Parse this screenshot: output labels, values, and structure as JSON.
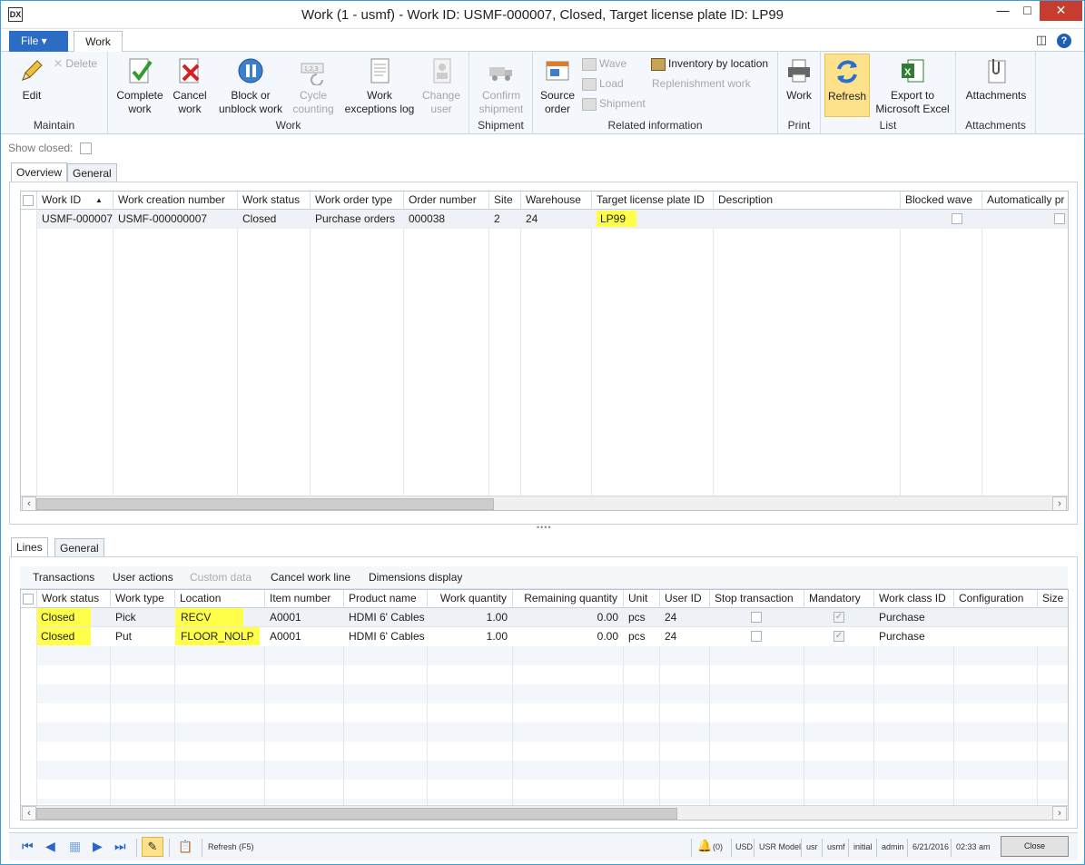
{
  "window": {
    "title": "Work (1 - usmf) - Work ID: USMF-000007, Closed, Target license plate ID: LP99"
  },
  "tabs": {
    "file": "File",
    "work": "Work"
  },
  "ribbon": {
    "maintain": {
      "label": "Maintain",
      "edit": "Edit",
      "delete": "Delete"
    },
    "work": {
      "label": "Work",
      "complete": [
        "Complete",
        "work"
      ],
      "cancel": [
        "Cancel",
        "work"
      ],
      "block": [
        "Block or",
        "unblock work"
      ],
      "cycle": [
        "Cycle",
        "counting"
      ],
      "exceptions": [
        "Work",
        "exceptions log"
      ],
      "change": [
        "Change",
        "user"
      ]
    },
    "shipment": {
      "label": "Shipment",
      "confirm": [
        "Confirm",
        "shipment"
      ]
    },
    "related": {
      "label": "Related information",
      "source": [
        "Source",
        "order"
      ],
      "wave": "Wave",
      "load": "Load",
      "shipment": "Shipment",
      "inventory": "Inventory by location",
      "replenishment": "Replenishment work"
    },
    "print": {
      "label": "Print",
      "work": "Work"
    },
    "list": {
      "label": "List",
      "refresh": "Refresh",
      "export": [
        "Export to",
        "Microsoft Excel"
      ]
    },
    "attachments": {
      "label": "Attachments",
      "attachments": "Attachments"
    }
  },
  "show_closed": "Show closed:",
  "header_tabs": {
    "overview": "Overview",
    "general": "General"
  },
  "work_grid": {
    "columns": [
      "Work ID",
      "Work creation number",
      "Work status",
      "Work order type",
      "Order number",
      "Site",
      "Warehouse",
      "Target license plate ID",
      "Description",
      "Blocked wave",
      "Automatically pr"
    ],
    "rows": [
      {
        "work_id": "USMF-000007",
        "creation": "USMF-000000007",
        "status": "Closed",
        "order_type": "Purchase orders",
        "order_number": "000038",
        "site": "2",
        "warehouse": "24",
        "lp": "LP99",
        "description": ""
      }
    ]
  },
  "line_tabs": {
    "lines": "Lines",
    "general": "General"
  },
  "lines_toolbar": {
    "transactions": "Transactions",
    "user_actions": "User actions",
    "custom_data": "Custom data",
    "cancel_line": "Cancel work line",
    "dimensions": "Dimensions display"
  },
  "lines_grid": {
    "columns": [
      "Work status",
      "Work type",
      "Location",
      "Item number",
      "Product name",
      "Work quantity",
      "Remaining quantity",
      "Unit",
      "User ID",
      "Stop transaction",
      "Mandatory",
      "Work class ID",
      "Configuration",
      "Size"
    ],
    "rows": [
      {
        "status": "Closed",
        "type": "Pick",
        "location": "RECV",
        "item": "A0001",
        "product": "HDMI 6' Cables",
        "qty": "1.00",
        "remaining": "0.00",
        "unit": "pcs",
        "user": "24",
        "class": "Purchase"
      },
      {
        "status": "Closed",
        "type": "Put",
        "location": "FLOOR_NOLP",
        "item": "A0001",
        "product": "HDMI 6' Cables",
        "qty": "1.00",
        "remaining": "0.00",
        "unit": "pcs",
        "user": "24",
        "class": "Purchase"
      }
    ]
  },
  "statusbar": {
    "hint": "Refresh (F5)",
    "alerts": "(0)",
    "currency": "USD",
    "model": "USR Model",
    "layer": "usr",
    "company": "usmf",
    "partition": "initial",
    "user": "admin",
    "date": "6/21/2016",
    "time": "02:33 am",
    "close": "Close"
  }
}
